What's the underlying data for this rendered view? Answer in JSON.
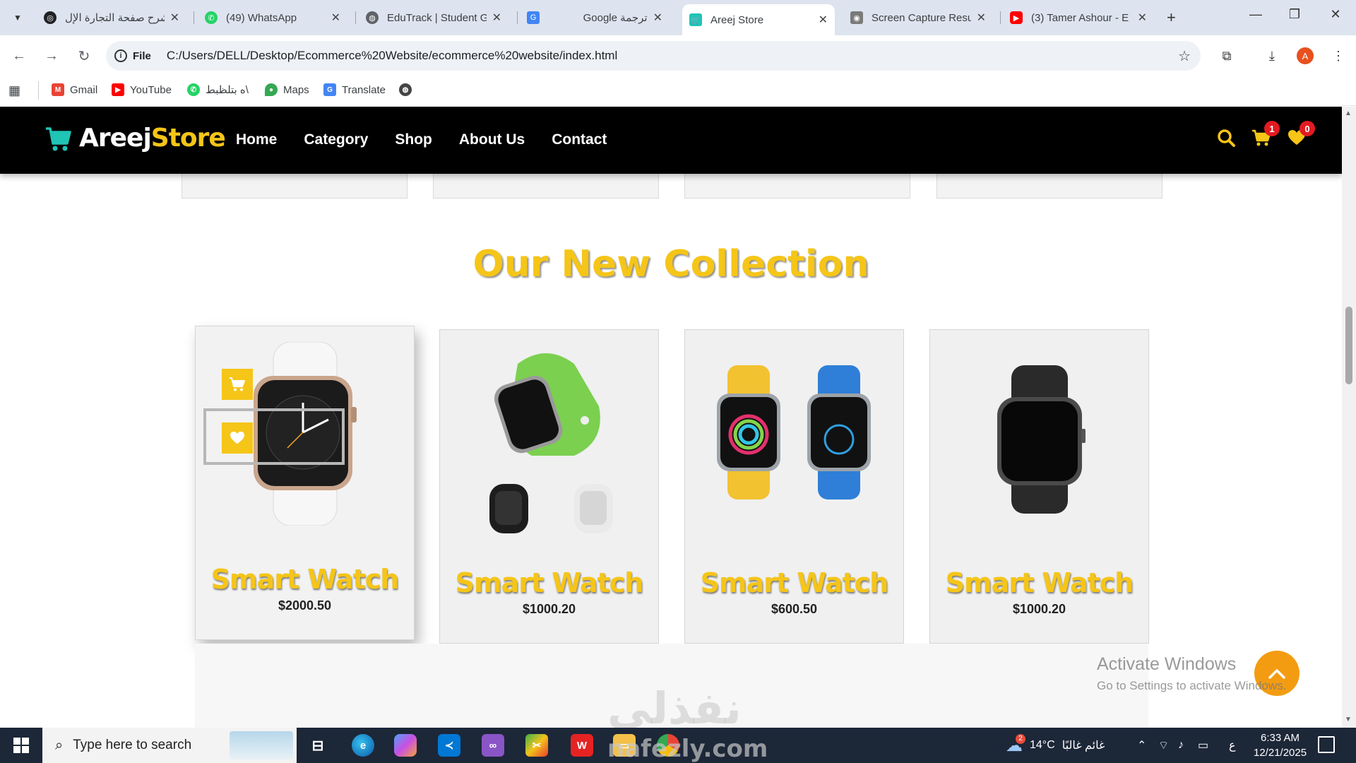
{
  "browser": {
    "tabs": [
      {
        "title": "شرح صفحة التجارة الإل",
        "icon": "chatgpt-icon",
        "color": "#202124"
      },
      {
        "title": "(49) WhatsApp",
        "icon": "whatsapp-icon",
        "color": "#25d366"
      },
      {
        "title": "EduTrack | Student G",
        "icon": "globe-icon",
        "color": "#5f6368"
      },
      {
        "title": "Google ترجمة",
        "icon": "translate-icon",
        "color": "#4285f4"
      },
      {
        "title": "Areej Store",
        "icon": "cart-icon",
        "color": "#20c4b5"
      },
      {
        "title": "Screen Capture Resu",
        "icon": "camera-icon",
        "color": "#7a7a7a"
      },
      {
        "title": "(3) Tamer Ashour - E",
        "icon": "youtube-icon",
        "color": "#ff0000"
      }
    ],
    "active_tab_index": 4,
    "url_scheme_chip": "File",
    "url": "C:/Users/DELL/Desktop/Ecommerce%20Website/ecommerce%20website/index.html",
    "profile_initial": "A",
    "bookmarks": [
      {
        "label": "Gmail",
        "icon": "gmail-icon",
        "color": "#ea4335"
      },
      {
        "label": "YouTube",
        "icon": "youtube-icon",
        "color": "#ff0000"
      },
      {
        "label": "ه بتلظبط\\",
        "icon": "whatsapp-icon",
        "color": "#25d366"
      },
      {
        "label": "Maps",
        "icon": "maps-icon",
        "color": "#34a853"
      },
      {
        "label": "Translate",
        "icon": "translate-icon",
        "color": "#4285f4"
      }
    ]
  },
  "site": {
    "logo_part1": "Areej",
    "logo_part2": "Store",
    "nav": [
      "Home",
      "Category",
      "Shop",
      "About Us",
      "Contact"
    ],
    "cart_count": "1",
    "wishlist_count": "0",
    "accent_color": "#f5c518",
    "section_title": "Our New Collection",
    "products": [
      {
        "name": "Smart Watch",
        "price": "$2000.50",
        "image": "white-band-watch"
      },
      {
        "name": "Smart Watch",
        "price": "$1000.20",
        "image": "green-band-watch-set"
      },
      {
        "name": "Smart Watch",
        "price": "$600.50",
        "image": "yellow-blue-watch-pair"
      },
      {
        "name": "Smart Watch",
        "price": "$1000.20",
        "image": "black-watch"
      }
    ]
  },
  "overlay": {
    "activate_title": "Activate Windows",
    "activate_sub": "Go to Settings to activate Windows.",
    "watermark_ar": "نفذلي",
    "watermark_en": "nafezly.com"
  },
  "taskbar": {
    "search_placeholder": "Type here to search",
    "weather_temp": "14°C",
    "weather_text": "غائم غالبًا",
    "weather_badge": "2",
    "lang": "ع",
    "time": "6:33 AM",
    "date": "12/21/2025"
  }
}
